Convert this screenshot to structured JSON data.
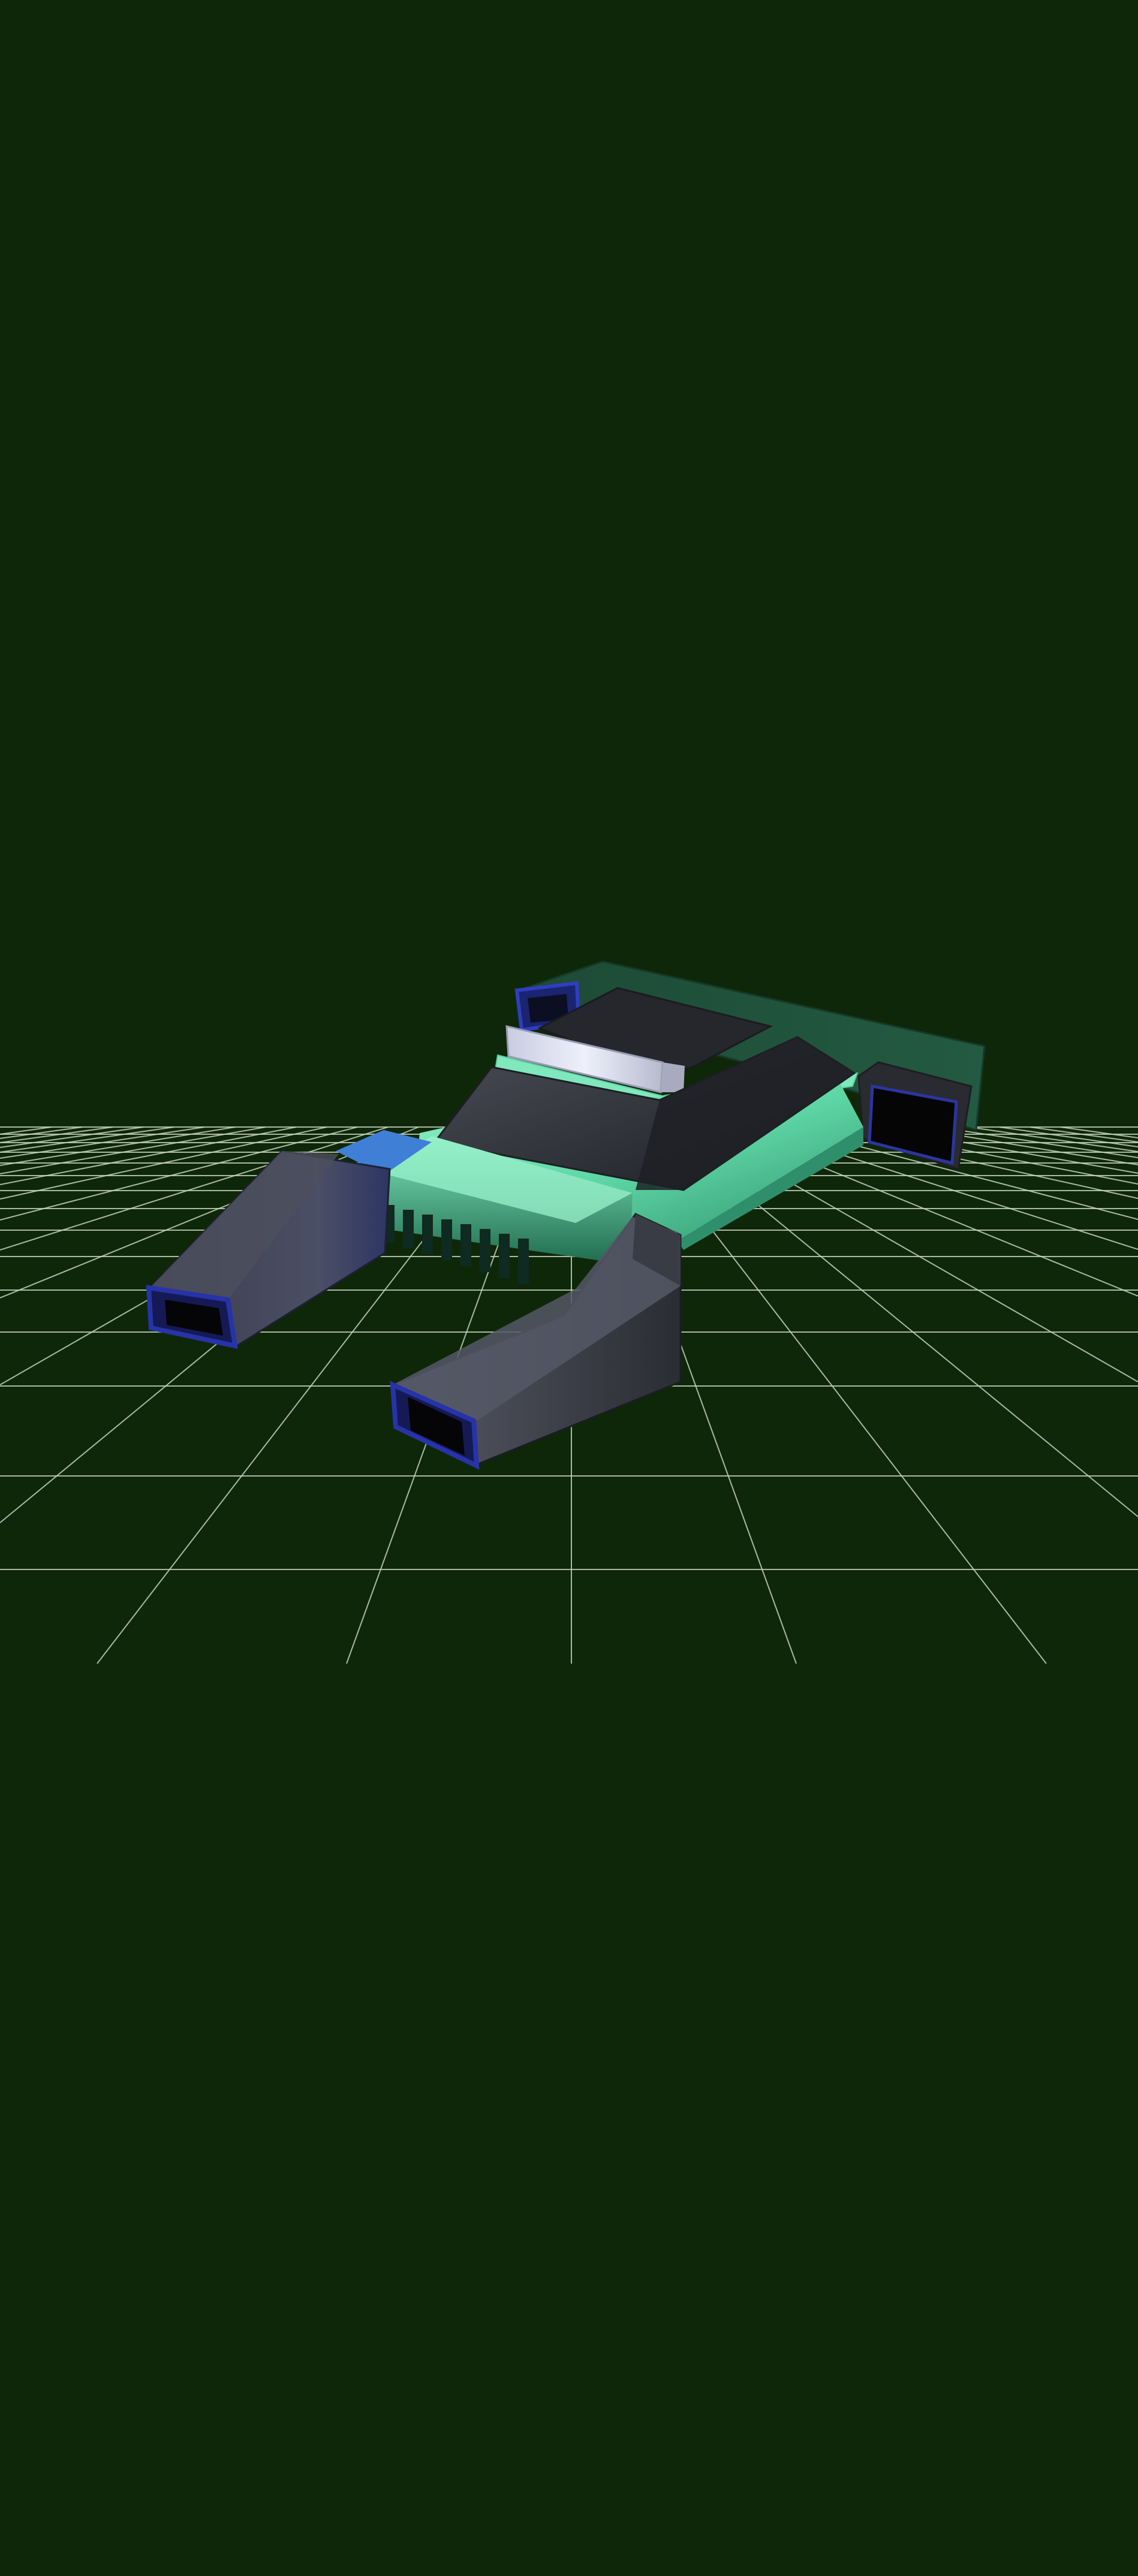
{
  "scene": {
    "description_visible_text": "",
    "colors": {
      "background": "#0f2709",
      "grid_lines": "#c7d3bd",
      "body_glow": "#6fe3b4",
      "body_glow_dark": "#2f8a6b",
      "dark_panel": "#2a2c31",
      "dark_panel_top": "#3b3d45",
      "blue_trim": "#2733a8",
      "blue_accent": "#3f7fd6",
      "back_slab": "#1f4a35",
      "light_bar": "#d9dcef"
    }
  }
}
